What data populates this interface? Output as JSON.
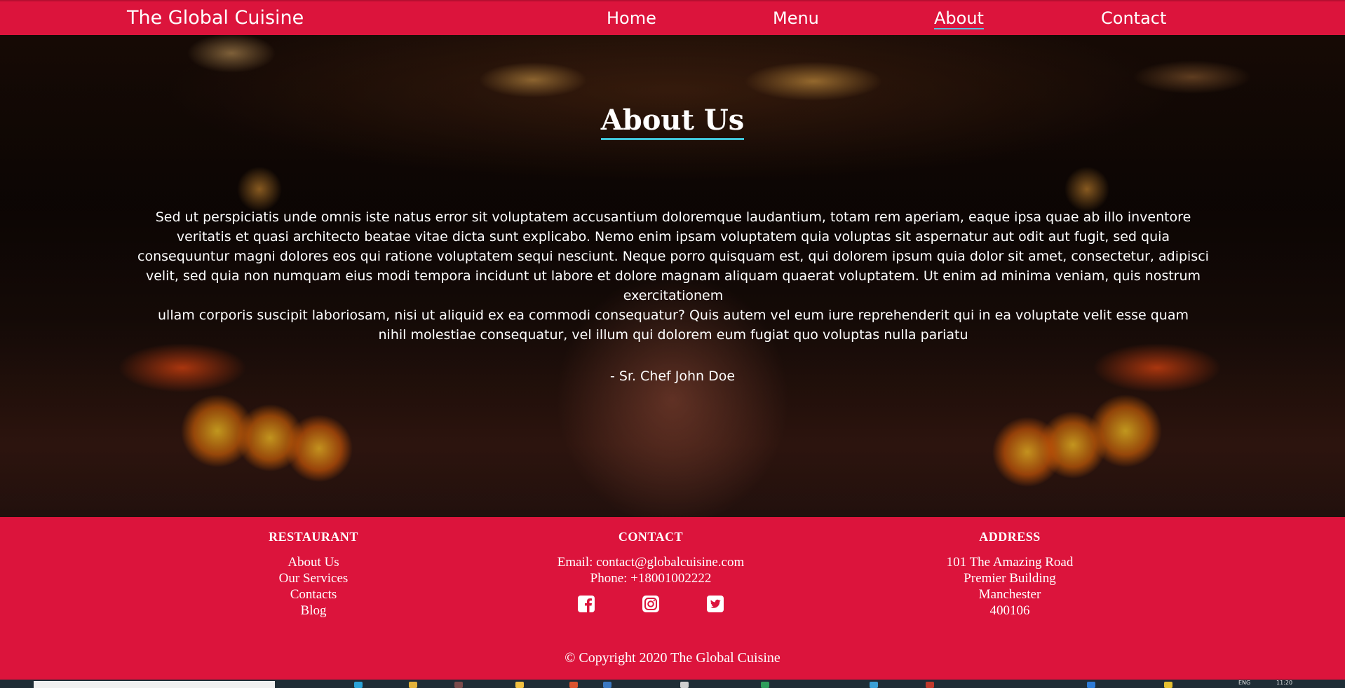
{
  "navbar": {
    "brand": "The Global Cuisine",
    "links": [
      {
        "label": "Home"
      },
      {
        "label": "Menu"
      },
      {
        "label": "About"
      },
      {
        "label": "Contact"
      }
    ],
    "active": "About"
  },
  "hero": {
    "title": "About Us",
    "paragraph1": "Sed ut perspiciatis unde omnis iste natus error sit voluptatem accusantium doloremque laudantium, totam rem aperiam, eaque ipsa quae ab illo inventore veritatis et quasi architecto beatae vitae dicta sunt explicabo. Nemo enim ipsam voluptatem quia voluptas sit aspernatur aut odit aut fugit, sed quia consequuntur magni dolores eos qui ratione voluptatem sequi nesciunt. Neque porro quisquam est, qui dolorem ipsum quia dolor sit amet, consectetur, adipisci velit, sed quia non numquam eius modi tempora incidunt ut labore et dolore magnam aliquam quaerat voluptatem. Ut enim ad minima veniam, quis nostrum exercitationem",
    "paragraph2": "ullam corporis suscipit laboriosam, nisi ut aliquid ex ea commodi consequatur? Quis autem vel eum iure reprehenderit qui in ea voluptate velit esse quam nihil molestiae consequatur, vel illum qui dolorem eum fugiat quo voluptas nulla pariatu",
    "signature": "- Sr. Chef John Doe"
  },
  "footer": {
    "restaurant": {
      "heading": "RESTAURANT",
      "links": [
        "About Us",
        "Our Services",
        "Contacts",
        "Blog"
      ]
    },
    "contact": {
      "heading": "CONTACT",
      "email": "Email: contact@globalcuisine.com",
      "phone": "Phone: +18001002222",
      "social_icons": [
        "facebook-icon",
        "instagram-icon",
        "twitter-icon"
      ]
    },
    "address": {
      "heading": "ADDRESS",
      "lines": [
        "101 The Amazing Road",
        "Premier Building",
        "Manchester",
        "400106"
      ]
    },
    "copyright": "© Copyright 2020 The Global Cuisine"
  },
  "taskbar": {
    "language": "ENG",
    "time": "11:20"
  },
  "colors": {
    "brand_red": "#dc143c",
    "accent_underline": "#40c4d6",
    "text": "#ffffff"
  }
}
